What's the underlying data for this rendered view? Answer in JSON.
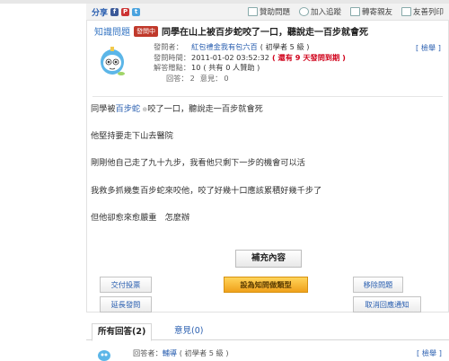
{
  "toolbar": {
    "share_label": "分享",
    "items": [
      "贊助問題",
      "加入追蹤",
      "轉寄親友",
      "友善列印"
    ],
    "colors": {
      "fb": "#3b5998",
      "plurk": "#cc3333",
      "twitter": "#4aa3df"
    }
  },
  "question": {
    "category": "知識問題",
    "status_badge": "發問中",
    "title": "同學在山上被百步蛇咬了一口，聽說走一百步就會死",
    "report_label": "[ 檢舉 ]",
    "asker_label": "發問者：",
    "asker_name": "紅包禮金我有包六百",
    "asker_level": "( 初學者 5 級 )",
    "time_label": "發問時間：",
    "time_value": "2011-01-02 03:52:32",
    "time_remaining": "( 還有 9 天發問到期 )",
    "points_label": "解答贈點：",
    "points_value": "10",
    "points_note": "( 共有 0 人贊助 )",
    "stats_label": "回答：",
    "stats_value": "2",
    "opinion_label": "意見：",
    "opinion_value": "0",
    "body_line1_pre": "同學被",
    "body_line1_link": "百步蛇",
    "body_line1_post": "咬了一口，聽說走一百步就會死",
    "body_line2": "他堅持要走下山去醫院",
    "body_line3": "剛剛他自己走了九十九步，我看他只剩下一步的機會可以活",
    "body_line4": "我救多抓幾隻百步蛇來咬他，咬了好幾十口應該累積好幾千步了",
    "body_line5": "但他卻愈來愈嚴重　怎麼辦"
  },
  "actions": {
    "supplement": "補充內容",
    "vote": "交付投票",
    "interesting": "設為知問做類型",
    "move": "移除問題",
    "extend": "延長發問",
    "cancel_notify": "取消回應通知"
  },
  "tabs": {
    "all_answers": "所有回答(2)",
    "opinions": "意見(0)"
  },
  "answer": {
    "label": "回答者：",
    "name": "輔導",
    "level": "( 初學者 5 級 )",
    "report": "[ 檢舉 ]"
  }
}
